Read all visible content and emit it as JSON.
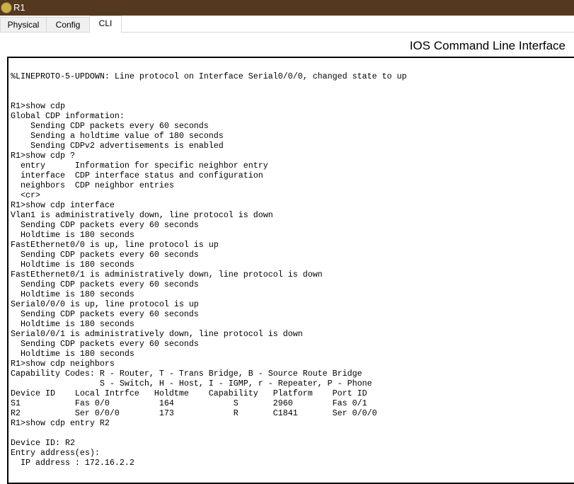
{
  "window": {
    "title": "R1",
    "icon": "packet-tracer-router-icon"
  },
  "tabs": [
    {
      "label": "Physical"
    },
    {
      "label": "Config"
    },
    {
      "label": "CLI",
      "active": true
    }
  ],
  "heading": "IOS Command Line Interface",
  "terminal": {
    "lines": [
      "%LINEPROTO-5-UPDOWN: Line protocol on Interface Serial0/0/0, changed state to up",
      "",
      "",
      "R1>show cdp",
      "Global CDP information:",
      "    Sending CDP packets every 60 seconds",
      "    Sending a holdtime value of 180 seconds",
      "    Sending CDPv2 advertisements is enabled",
      "R1>show cdp ?",
      "  entry      Information for specific neighbor entry",
      "  interface  CDP interface status and configuration",
      "  neighbors  CDP neighbor entries",
      "  <cr>",
      "R1>show cdp interface",
      "Vlan1 is administratively down, line protocol is down",
      "  Sending CDP packets every 60 seconds",
      "  Holdtime is 180 seconds",
      "FastEthernet0/0 is up, line protocol is up",
      "  Sending CDP packets every 60 seconds",
      "  Holdtime is 180 seconds",
      "FastEthernet0/1 is administratively down, line protocol is down",
      "  Sending CDP packets every 60 seconds",
      "  Holdtime is 180 seconds",
      "Serial0/0/0 is up, line protocol is up",
      "  Sending CDP packets every 60 seconds",
      "  Holdtime is 180 seconds",
      "Serial0/0/1 is administratively down, line protocol is down",
      "  Sending CDP packets every 60 seconds",
      "  Holdtime is 180 seconds",
      "R1>show cdp neighbors",
      "Capability Codes: R - Router, T - Trans Bridge, B - Source Route Bridge",
      "                  S - Switch, H - Host, I - IGMP, r - Repeater, P - Phone",
      "Device ID    Local Intrfce   Holdtme    Capability   Platform    Port ID",
      "S1           Fas 0/0          164            S       2960        Fas 0/1",
      "R2           Ser 0/0/0        173            R       C1841       Ser 0/0/0",
      "R1>show cdp entry R2",
      "",
      "Device ID: R2",
      "Entry address(es):",
      "  IP address : 172.16.2.2"
    ]
  }
}
